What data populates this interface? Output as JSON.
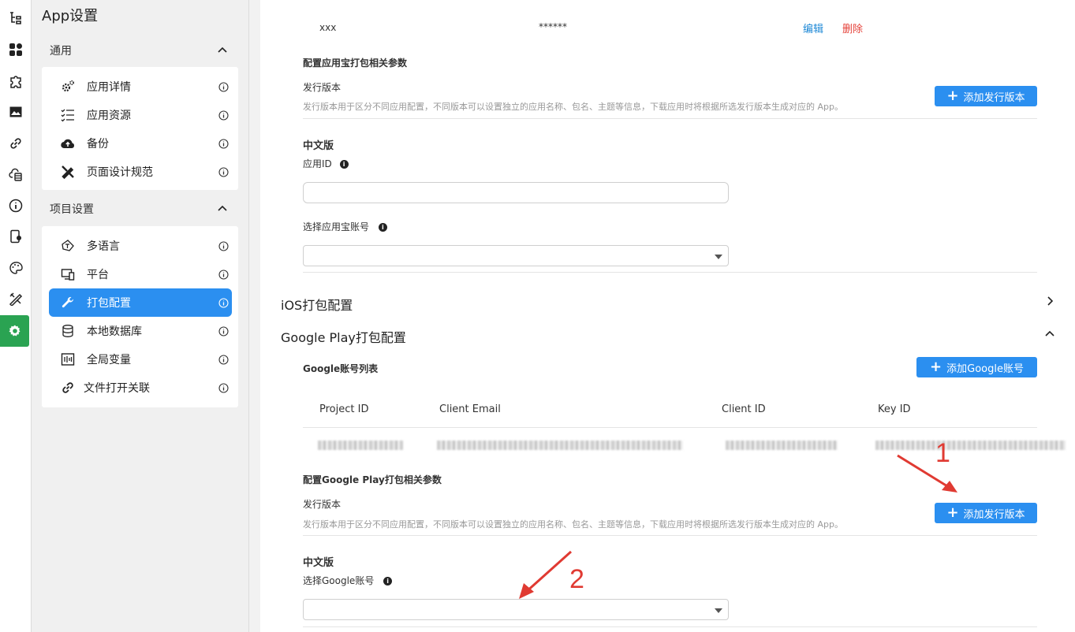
{
  "nav": {
    "title": "App设置",
    "groups": [
      {
        "label": "通用",
        "items": [
          {
            "label": "应用详情",
            "icon": "gears-icon"
          },
          {
            "label": "应用资源",
            "icon": "checklist-icon"
          },
          {
            "label": "备份",
            "icon": "cloud-upload-icon"
          },
          {
            "label": "页面设计规范",
            "icon": "design-tools-icon"
          }
        ]
      },
      {
        "label": "项目设置",
        "items": [
          {
            "label": "多语言",
            "icon": "translate-icon"
          },
          {
            "label": "平台",
            "icon": "devices-icon"
          },
          {
            "label": "打包配置",
            "icon": "wrench-icon",
            "active": true
          },
          {
            "label": "本地数据库",
            "icon": "database-icon"
          },
          {
            "label": "全局变量",
            "icon": "variable-icon"
          },
          {
            "label": "文件打开关联",
            "icon": "link-icon"
          }
        ]
      }
    ]
  },
  "top_row": {
    "name": "xxx",
    "password": "******",
    "edit": "编辑",
    "delete": "删除"
  },
  "yyb": {
    "params_title": "配置应用宝打包相关参数",
    "release_label": "发行版本",
    "release_hint": "发行版本用于区分不同应用配置，不同版本可以设置独立的应用名称、包名、主题等信息，下载应用时将根据所选发行版本生成对应的 App。",
    "add_release": "添加发行版本",
    "version_name": "中文版",
    "app_id_label": "应用ID",
    "app_id_value": "",
    "account_label": "选择应用宝账号",
    "account_value": ""
  },
  "ios": {
    "title": "iOS打包配置"
  },
  "gp": {
    "title": "Google Play打包配置",
    "accounts_title": "Google账号列表",
    "add_account": "添加Google账号",
    "columns": [
      "Project ID",
      "Client Email",
      "Client ID",
      "Key ID"
    ],
    "params_title": "配置Google Play打包相关参数",
    "release_label": "发行版本",
    "release_hint": "发行版本用于区分不同应用配置，不同版本可以设置独立的应用名称、包名、主题等信息，下载应用时将根据所选发行版本生成对应的 App。",
    "add_release": "添加发行版本",
    "version_name": "中文版",
    "account_label": "选择Google账号",
    "account_value": ""
  },
  "annotations": {
    "one": "1",
    "two": "2",
    "color": "#e03a32"
  },
  "colors": {
    "accent": "#2b8ff0",
    "active_rail": "#2aa352",
    "delete": "#e5433b",
    "edit": "#1e88d6"
  }
}
